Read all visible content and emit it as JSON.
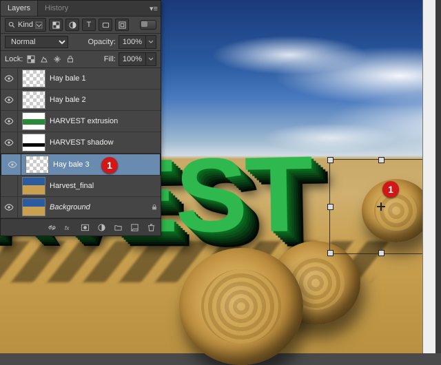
{
  "tabs": {
    "layers": "Layers",
    "history": "History"
  },
  "filter": {
    "kind_label": "Kind"
  },
  "blend": {
    "mode": "Normal",
    "opacity_label": "Opacity:",
    "opacity_value": "100%"
  },
  "lock": {
    "label": "Lock:",
    "fill_label": "Fill:",
    "fill_value": "100%"
  },
  "layers": [
    {
      "name": "Hay bale 1",
      "visible": true,
      "thumb": "check",
      "locked": false,
      "italic": false
    },
    {
      "name": "Hay bale 2",
      "visible": true,
      "thumb": "check",
      "locked": false,
      "italic": false
    },
    {
      "name": "HARVEST extrusion",
      "visible": true,
      "thumb": "ext",
      "locked": false,
      "italic": false
    },
    {
      "name": "HARVEST shadow",
      "visible": true,
      "thumb": "sh",
      "locked": false,
      "italic": false
    },
    {
      "name": "Hay bale 3",
      "visible": true,
      "thumb": "check",
      "locked": false,
      "italic": false,
      "selected": true
    },
    {
      "name": "Harvest_final",
      "visible": false,
      "thumb": "img",
      "locked": false,
      "italic": false
    },
    {
      "name": "Background",
      "visible": true,
      "thumb": "img",
      "locked": true,
      "italic": true
    }
  ],
  "canvas": {
    "text": "RVEST"
  },
  "markers": {
    "panel": "1",
    "canvas": "1"
  }
}
